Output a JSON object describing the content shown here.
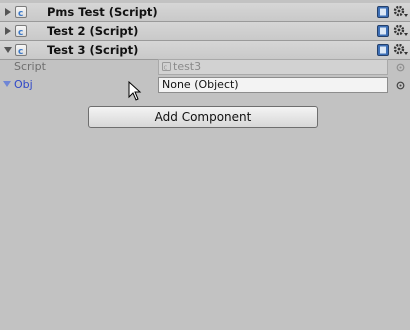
{
  "components": [
    {
      "title": "Pms Test (Script)",
      "expanded": false,
      "icon": "script-icon"
    },
    {
      "title": "Test 2 (Script)",
      "expanded": false,
      "icon": "script-icon"
    },
    {
      "title": "Test 3 (Script)",
      "expanded": true,
      "icon": "script-icon"
    }
  ],
  "test3_properties": {
    "script": {
      "label": "Script",
      "value": "test3",
      "disabled": true
    },
    "obj": {
      "label": "Obj",
      "value": "None (Object)",
      "selected": true
    }
  },
  "add_component_label": "Add Component",
  "colors": {
    "background": "#c2c2c2",
    "selected_label": "#2f48c8",
    "script_icon_blue": "#3a78c8"
  }
}
